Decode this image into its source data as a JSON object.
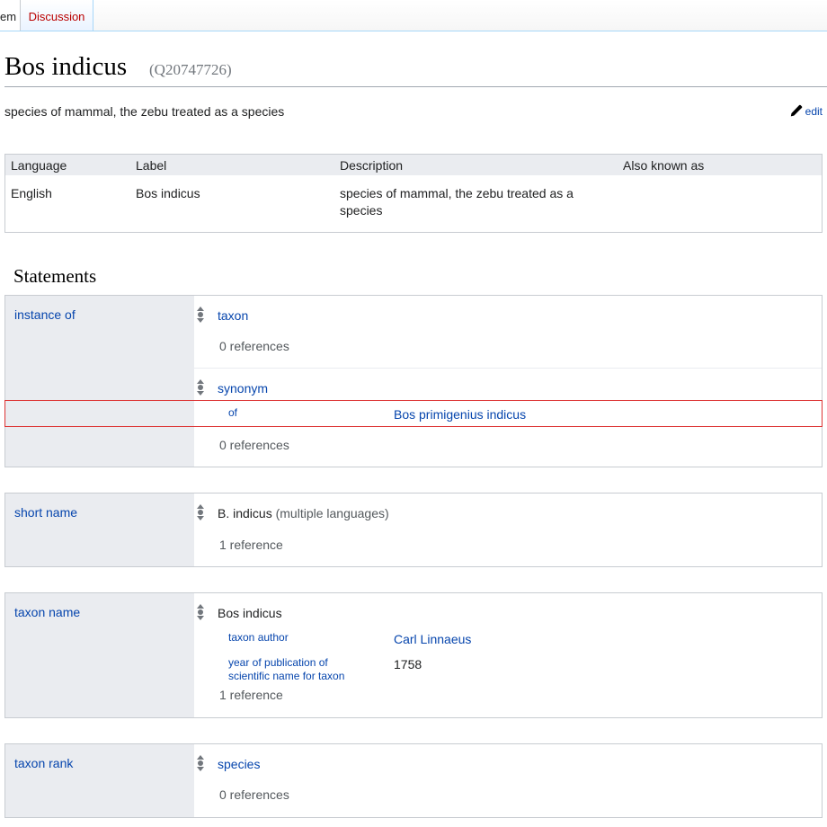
{
  "tabs": {
    "item": "em",
    "discussion": "Discussion"
  },
  "entity": {
    "label": "Bos indicus",
    "qid": "(Q20747726)",
    "description": "species of mammal, the zebu treated as a species",
    "edit": "edit"
  },
  "terms": {
    "headers": [
      "Language",
      "Label",
      "Description",
      "Also known as"
    ],
    "row": {
      "language": "English",
      "label": "Bos indicus",
      "description": "species of mammal, the zebu treated as a species",
      "aliases": ""
    }
  },
  "statements_title": "Statements",
  "statements": {
    "instance_of": {
      "property": "instance of",
      "values": [
        {
          "value": "taxon",
          "refs": "0 references"
        },
        {
          "value": "synonym",
          "qualifier_prop": "of",
          "qualifier_val": "Bos primigenius indicus",
          "refs": "0 references"
        }
      ]
    },
    "short_name": {
      "property": "short name",
      "value": "B. indicus",
      "value_note": "(multiple languages)",
      "refs": "1 reference"
    },
    "taxon_name": {
      "property": "taxon name",
      "value": "Bos indicus",
      "qualifiers": [
        {
          "prop": "taxon author",
          "val": "Carl Linnaeus"
        },
        {
          "prop": "year of publication of scientific name for taxon",
          "val": "1758"
        }
      ],
      "refs": "1 reference"
    },
    "taxon_rank": {
      "property": "taxon rank",
      "value": "species",
      "refs": "0 references"
    }
  },
  "colors": {
    "link": "#0645ad",
    "highlight": "#dd3333",
    "panel": "#eaecf0"
  }
}
